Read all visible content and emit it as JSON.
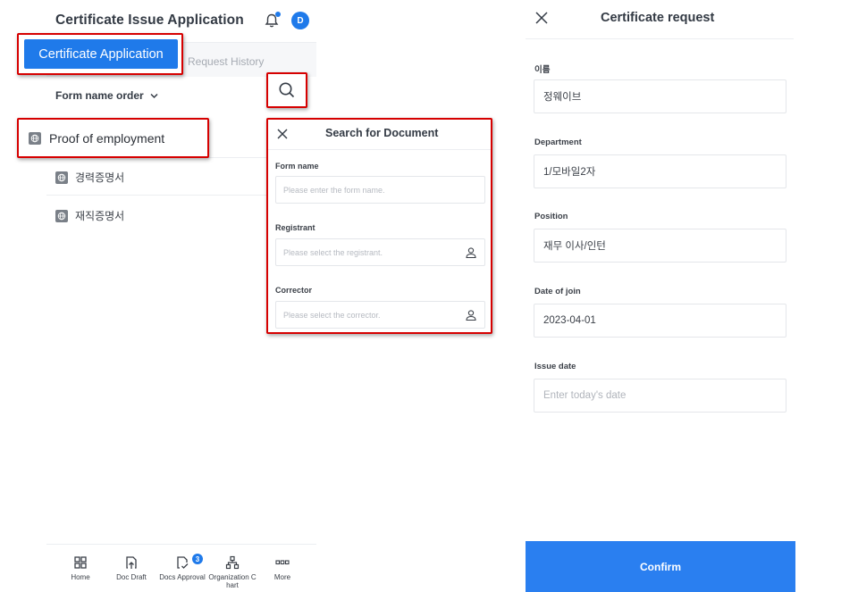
{
  "header": {
    "title": "Certificate Issue Application",
    "avatar_initial": "D"
  },
  "tabs": {
    "active": "Certificate Application",
    "history": "Request History"
  },
  "sort": {
    "label": "Form name order"
  },
  "list": {
    "items": [
      {
        "label": "Proof of employment"
      },
      {
        "label": "경력증명서"
      },
      {
        "label": "재직증명서"
      }
    ]
  },
  "search_panel": {
    "title": "Search for Document",
    "form_name_label": "Form name",
    "form_name_placeholder": "Please enter the form name.",
    "registrant_label": "Registrant",
    "registrant_placeholder": "Please select the registrant.",
    "corrector_label": "Corrector",
    "corrector_placeholder": "Please select the corrector."
  },
  "nav": {
    "items": [
      {
        "label": "Home"
      },
      {
        "label": "Doc Draft"
      },
      {
        "label": "Docs Approval"
      },
      {
        "label": "Organization C hart"
      },
      {
        "label": "More"
      }
    ],
    "approval_badge": "3"
  },
  "form": {
    "title": "Certificate request",
    "name_label": "이름",
    "name_value": "정웨이브",
    "department_label": "Department",
    "department_value": "1/모바일2자",
    "position_label": "Position",
    "position_value": "재무 이사/인턴",
    "join_label": "Date of join",
    "join_value": "2023-04-01",
    "issue_label": "Issue date",
    "issue_placeholder": "Enter today's date",
    "confirm_label": "Confirm"
  },
  "colors": {
    "accent": "#1f7aea",
    "highlight": "#d60000",
    "confirm": "#2a7ff0"
  }
}
